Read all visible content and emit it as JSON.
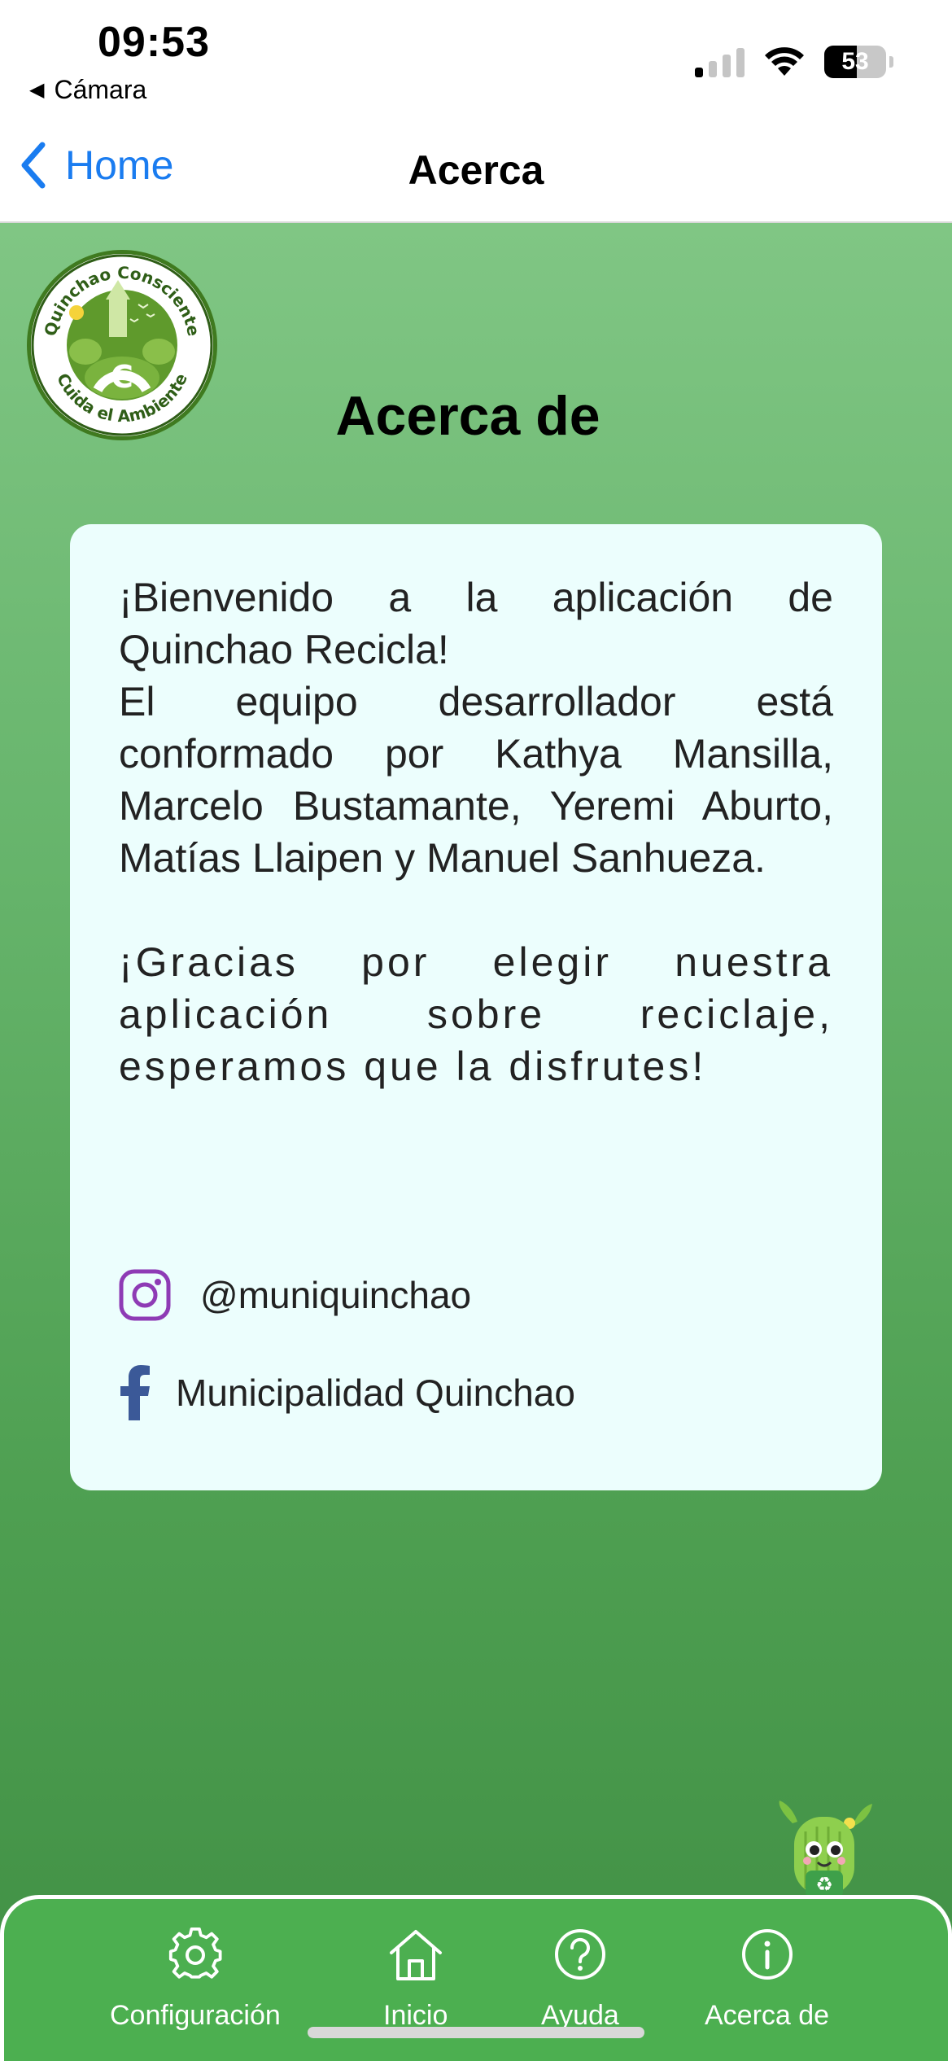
{
  "status_bar": {
    "time": "09:53",
    "back_app": "Cámara",
    "battery_level": "53",
    "battery_fraction": 0.53,
    "signal_bars_active": 1,
    "icons": [
      "cellular-signal-icon",
      "wifi-icon",
      "battery-icon"
    ]
  },
  "nav": {
    "back_label": "Home",
    "title": "Acerca"
  },
  "logo": {
    "top_text": "Quinchao Consciente",
    "bottom_text": "Cuida el Ambiente"
  },
  "page": {
    "title": "Acerca de"
  },
  "card": {
    "welcome": "¡Bienvenido a la aplicación de Quinchao Recicla!",
    "team": "El equipo desarrollador está conformado por Kathya Mansilla, Marcelo Bustamante, Yeremi Aburto, Matías Llaipen y Manuel Sanhueza.",
    "thanks": "¡Gracias por elegir nuestra aplicación sobre reciclaje, esperamos que la disfrutes!",
    "instagram": "@muniquinchao",
    "facebook": "Municipalidad Quinchao"
  },
  "tabs": [
    {
      "label": "Configuración",
      "icon": "gear-icon"
    },
    {
      "label": "Inicio",
      "icon": "home-icon"
    },
    {
      "label": "Ayuda",
      "icon": "help-circle-icon"
    },
    {
      "label": "Acerca de",
      "icon": "info-circle-icon"
    }
  ],
  "colors": {
    "accent_blue": "#1a7cf0",
    "background_green_top": "#80c684",
    "background_green_bottom": "#408f44",
    "card_background": "#ecfefd",
    "tab_bar": "#4caf50",
    "instagram": "#8e3bb5",
    "facebook": "#3b5998"
  }
}
